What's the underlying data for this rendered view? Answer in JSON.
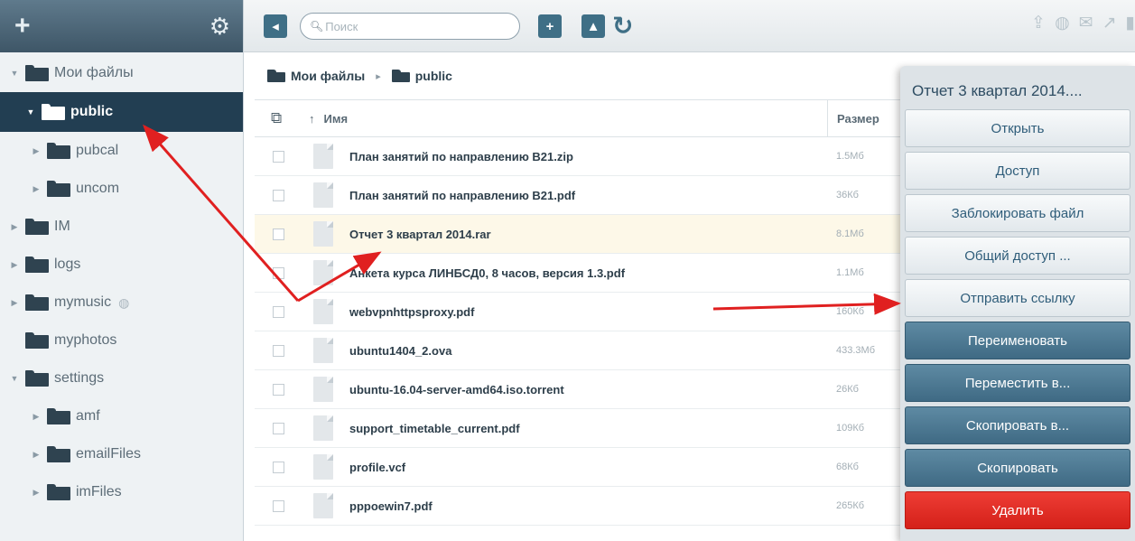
{
  "toolbar": {
    "add_icon": "plus-icon",
    "settings_icon": "gear-icon",
    "search_placeholder": "Поиск",
    "right_icons": [
      "upload-icon",
      "globe-icon",
      "link-off-icon",
      "share-icon",
      "trash-icon"
    ]
  },
  "sidebar": {
    "items": [
      {
        "label": "Мои файлы",
        "level": 0,
        "expanded": true
      },
      {
        "label": "public",
        "level": 1,
        "expanded": true,
        "selected": true
      },
      {
        "label": "pubcal",
        "level": 2
      },
      {
        "label": "uncom",
        "level": 2
      },
      {
        "label": "IM",
        "level": 1
      },
      {
        "label": "logs",
        "level": 1
      },
      {
        "label": "mymusic",
        "level": 1,
        "shared": true
      },
      {
        "label": "myphotos",
        "level": 1,
        "no_arrow": true
      },
      {
        "label": "settings",
        "level": 1,
        "expanded": true
      },
      {
        "label": "amf",
        "level": 2
      },
      {
        "label": "emailFiles",
        "level": 2
      },
      {
        "label": "imFiles",
        "level": 2
      }
    ]
  },
  "breadcrumb": {
    "root": "Мои файлы",
    "current": "public"
  },
  "list": {
    "columns": {
      "name": "Имя",
      "size": "Размер"
    },
    "files": [
      {
        "name": "План занятий по направлению B21.zip",
        "size": "1.5Мб"
      },
      {
        "name": "План занятий по направлению B21.pdf",
        "size": "36Кб"
      },
      {
        "name": "Отчет 3 квартал 2014.rar",
        "size": "8.1Мб"
      },
      {
        "name": "Анкета курса ЛИНБСД0, 8 часов, версия 1.3.pdf",
        "size": "1.1Мб"
      },
      {
        "name": "webvpnhttpsproxy.pdf",
        "size": "160Кб"
      },
      {
        "name": "ubuntu1404_2.ova",
        "size": "433.3Мб"
      },
      {
        "name": "ubuntu-16.04-server-amd64.iso.torrent",
        "size": "26Кб"
      },
      {
        "name": "support_timetable_current.pdf",
        "size": "109Кб"
      },
      {
        "name": "profile.vcf",
        "size": "68Кб"
      },
      {
        "name": "pppoewin7.pdf",
        "size": "265Кб"
      }
    ]
  },
  "context_menu": {
    "title": "Отчет 3 квартал 2014....",
    "items": [
      {
        "label": "Открыть",
        "style": "light"
      },
      {
        "label": "Доступ",
        "style": "light"
      },
      {
        "label": "Заблокировать файл",
        "style": "light"
      },
      {
        "label": "Общий доступ ...",
        "style": "light"
      },
      {
        "label": "Отправить ссылку",
        "style": "light"
      },
      {
        "label": "Переименовать",
        "style": "dark"
      },
      {
        "label": "Переместить в...",
        "style": "dark"
      },
      {
        "label": "Скопировать в...",
        "style": "dark"
      },
      {
        "label": "Скопировать",
        "style": "dark"
      },
      {
        "label": "Удалить",
        "style": "danger"
      }
    ]
  },
  "colors": {
    "accent": "#3f6f86",
    "selected": "#223e52",
    "danger": "#d42019",
    "annotation": "#e02020"
  }
}
